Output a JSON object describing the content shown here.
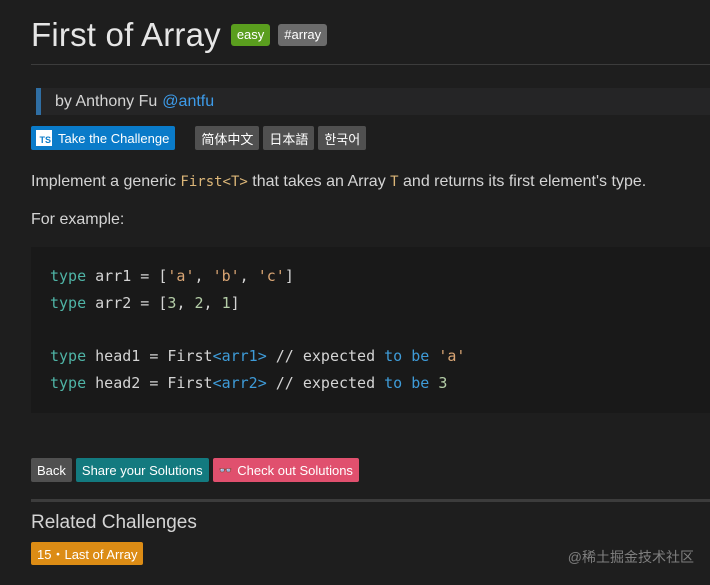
{
  "header": {
    "title": "First of Array",
    "badges": [
      "easy",
      "#array"
    ]
  },
  "author": {
    "prefix": "by Anthony Fu",
    "handle": "@antfu"
  },
  "buttons": {
    "ts_label": "TS",
    "challenge": "Take the Challenge",
    "languages": [
      "简体中文",
      "日本語",
      "한국어"
    ]
  },
  "description": {
    "before": "Implement a generic ",
    "code1": "First<T>",
    "middle": " that takes an Array ",
    "code2": "T",
    "after": " and returns its first element's type."
  },
  "example_label": "For example:",
  "code": {
    "l1": {
      "kw": "type",
      "rest1": " arr1 = [",
      "s1": "'a'",
      "c1": ", ",
      "s2": "'b'",
      "c2": ", ",
      "s3": "'c'",
      "end": "]"
    },
    "l2": {
      "kw": "type",
      "rest1": " arr2 = [",
      "n1": "3",
      "c1": ", ",
      "n2": "2",
      "c2": ", ",
      "n3": "1",
      "end": "]"
    },
    "l3": {
      "kw": "type",
      "rest1": " head1 = First",
      "tp": "<arr1>",
      "comment": " // expected ",
      "to": "to",
      "sp": " ",
      "be": "be",
      "val": " 'a'"
    },
    "l4": {
      "kw": "type",
      "rest1": " head2 = First",
      "tp": "<arr2>",
      "comment": " // expected ",
      "to": "to",
      "sp": " ",
      "be": "be",
      "val": " 3"
    }
  },
  "actions": {
    "back": "Back",
    "share": "Share your Solutions",
    "check_icon": "👓",
    "check": "Check out Solutions"
  },
  "related": {
    "title": "Related Challenges",
    "item": "15・Last of Array"
  },
  "watermark": "@稀土掘金技术社区",
  "colors": {
    "easy_badge": "#5a9e1e",
    "challenge_button": "#0a7bc9",
    "share_button": "#137a7f",
    "check_button": "#e0506e",
    "related_item": "#dc8c15",
    "link": "#3d9be9"
  }
}
